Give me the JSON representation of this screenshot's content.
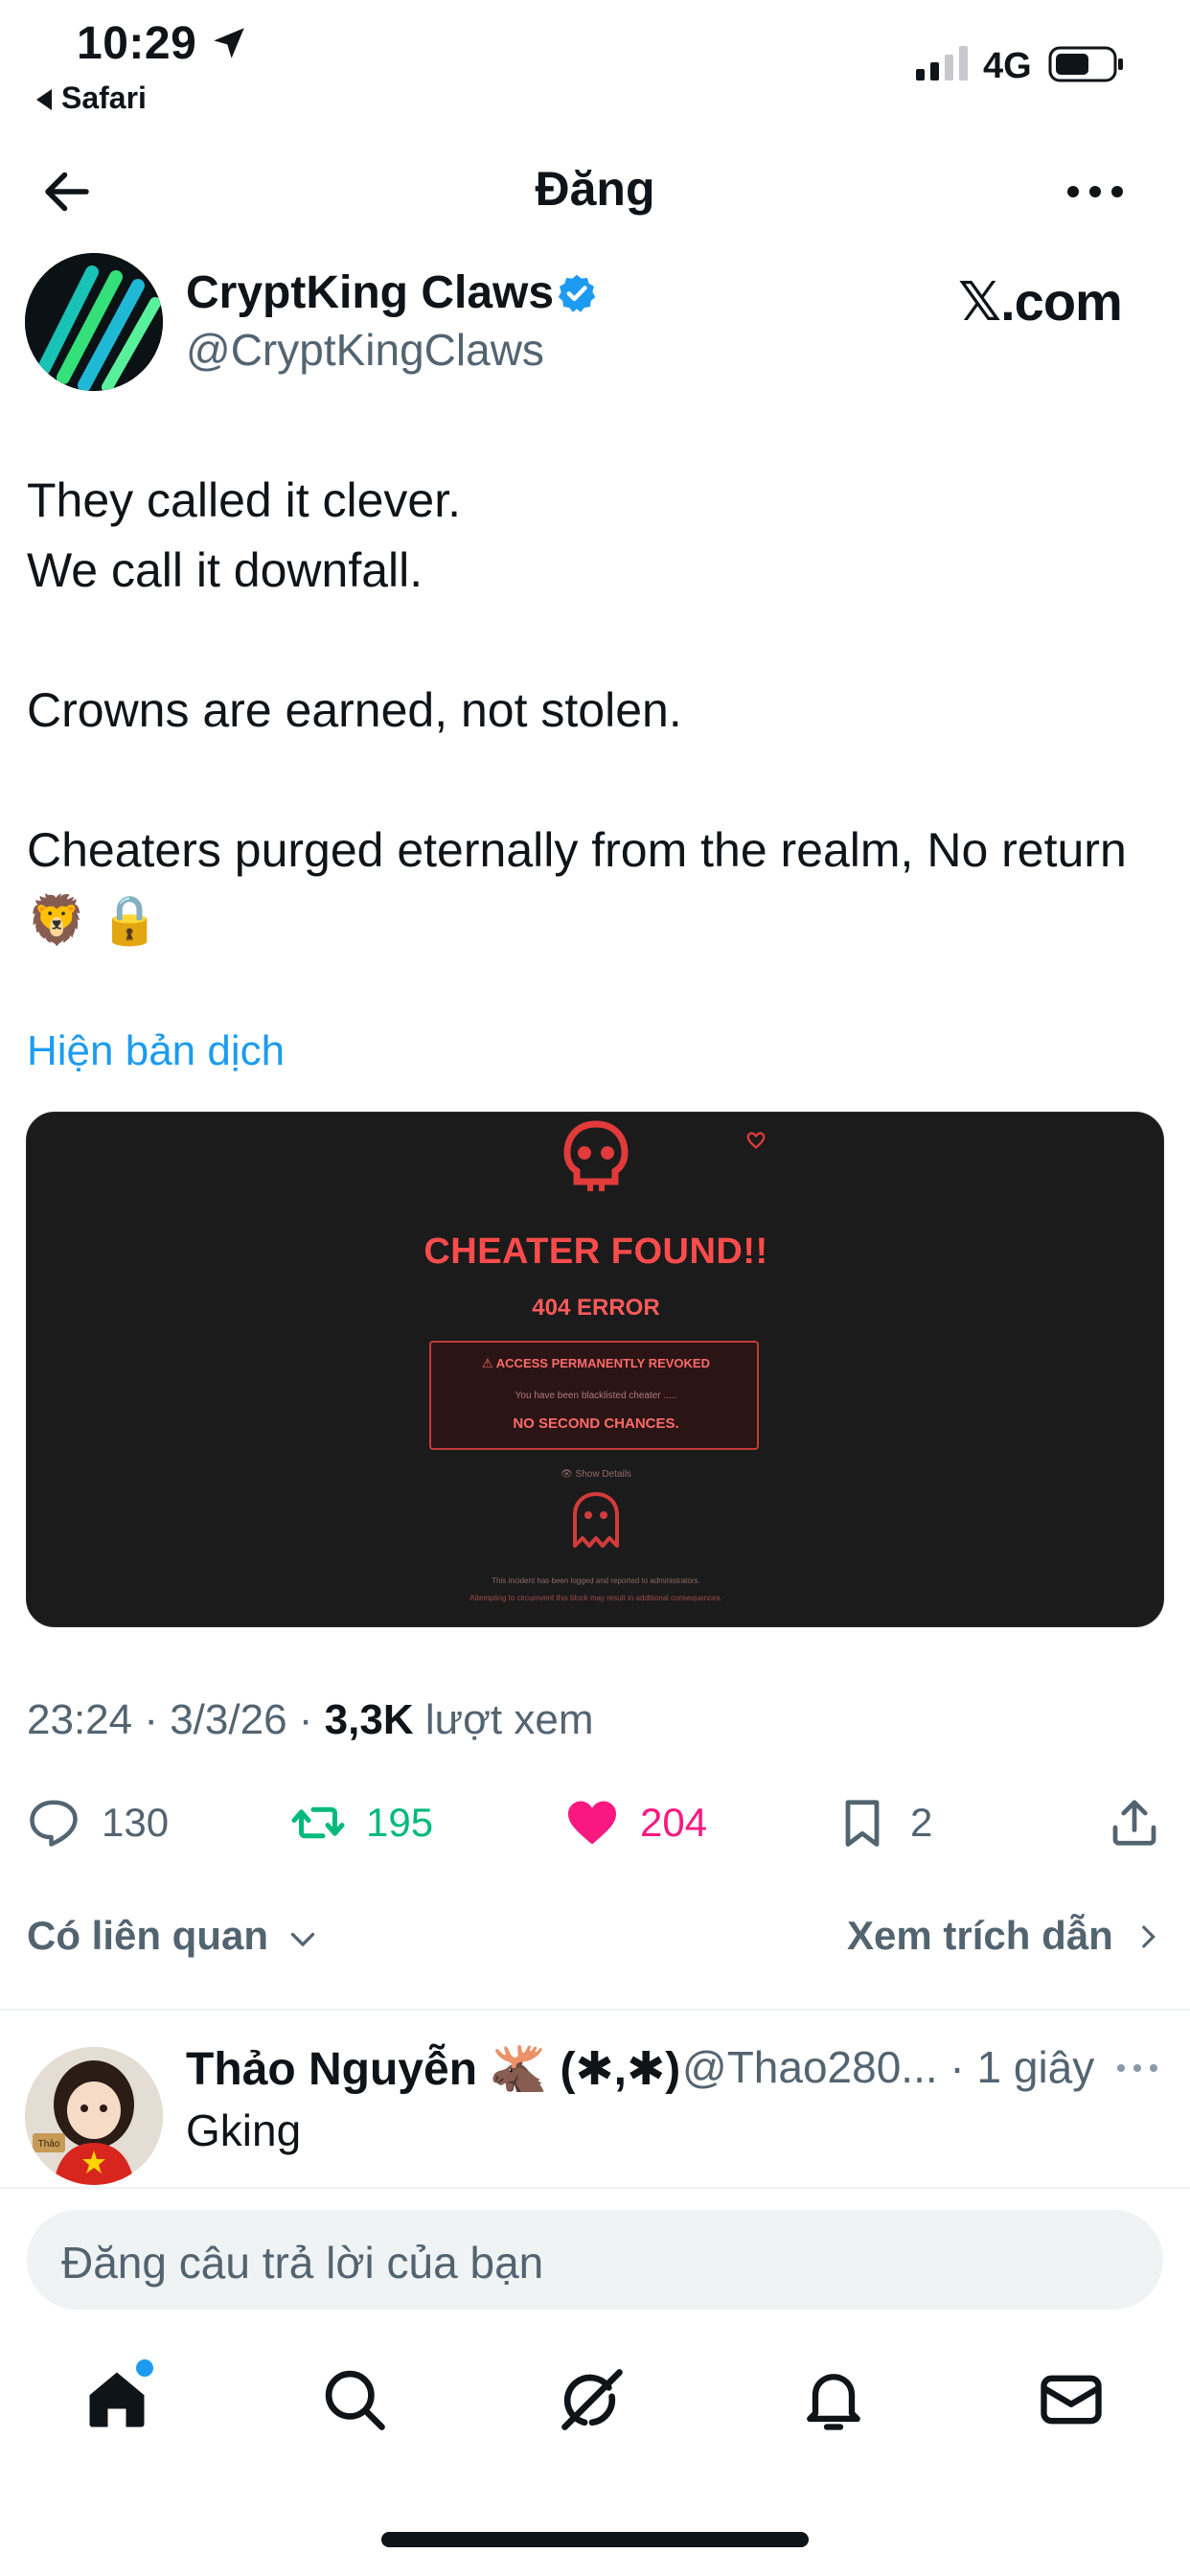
{
  "status_bar": {
    "time": "10:29",
    "back_app": "Safari",
    "network": "4G"
  },
  "nav": {
    "title": "Đăng"
  },
  "author": {
    "name": "CryptKing Claws",
    "handle": "@CryptKingClaws",
    "source": "𝕏.com"
  },
  "tweet": {
    "lines": [
      "They called it clever.",
      "We call it downfall.",
      "",
      "Crowns are earned, not stolen.",
      "",
      "Cheaters purged eternally from the realm, No return 🦁 🔒"
    ],
    "translate_label": "Hiện bản dịch"
  },
  "media": {
    "title": "CHEATER FOUND!!",
    "error": "404 ERROR",
    "box_heading": "⚠ ACCESS PERMANENTLY REVOKED",
    "box_sub": "You have been blacklisted cheater .....",
    "box_emphasis": "NO SECOND CHANCES.",
    "show_details": "👁 Show Details",
    "footnote1": "This incident has been logged and reported to administrators.",
    "footnote2": "Attempting to circumvent this block may result in additional consequences."
  },
  "meta": {
    "time_date": "23:24 · 3/3/26 · ",
    "views_count": "3,3K",
    "views_label": " lượt xem"
  },
  "actions": {
    "replies": "130",
    "reposts": "195",
    "likes": "204",
    "bookmarks": "2"
  },
  "related": {
    "left_label": "Có liên quan",
    "right_label": "Xem trích dẫn"
  },
  "reply": {
    "name": "Thảo Nguyễn 🫎 (✱,✱)",
    "handle_time": "@Thao280... · 1 giây",
    "text": "Gking",
    "avatar_label": "Thảo"
  },
  "composer": {
    "placeholder": "Đăng câu trả lời của bạn"
  },
  "colors": {
    "accent": "#1d9bf0",
    "repost": "#00ba7c",
    "like": "#f91880",
    "muted": "#536471"
  },
  "icons": [
    "location-arrow-icon",
    "signal-icon",
    "battery-icon",
    "back-arrow-icon",
    "more-icon",
    "verified-icon",
    "skull-icon",
    "ghost-icon",
    "reply-icon",
    "repost-icon",
    "heart-icon",
    "bookmark-icon",
    "share-icon",
    "chevron-down-icon",
    "chevron-right-icon",
    "home-icon",
    "search-icon",
    "grok-icon",
    "bell-icon",
    "mail-icon"
  ]
}
